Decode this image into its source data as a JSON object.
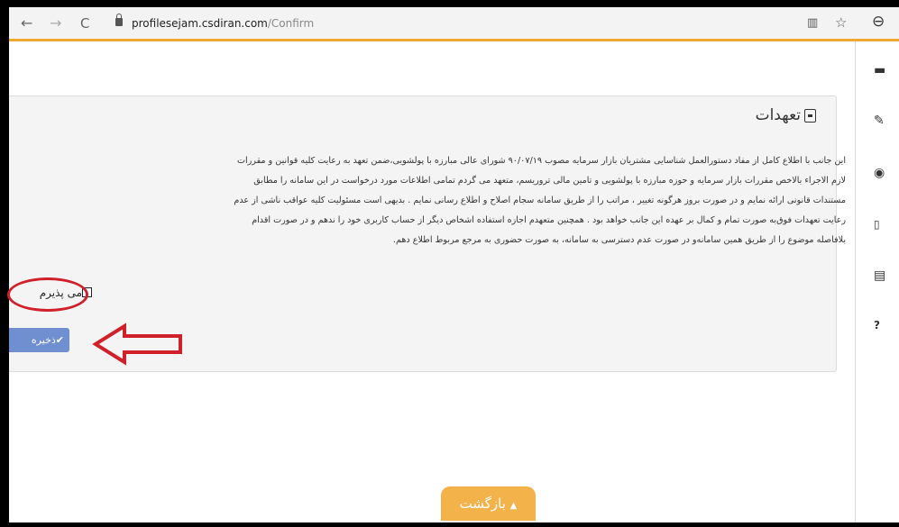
{
  "browser": {
    "url_host": "profilesejam.csdiran.com",
    "url_path": "/Confirm",
    "back_glyph": "←",
    "forward_glyph": "→",
    "reload_glyph": "C",
    "accent_color": "#f0a830"
  },
  "panel": {
    "title": "تعهدات",
    "terms_lines": [
      "این جانب با اطلاع کامل از مفاد دستورالعمل شناسایی مشتریان بازار سرمایه مصوب ۹۰/۰۷/۱۹ شورای عالی مبارزه با پولشویی،ضمن تعهد به رعایت کلیه قوانین و مقررات",
      "لازم الاجراء بالاخص مقررات بازار سرمایه و حوزه مبارزه با پولشویی و تامین مالی تروریسم، متعهد می گردم تمامی اطلاعات مورد درخواست در این سامانه را مطابق",
      "مستندات قانونی ارائه نمایم و در صورت بروز هرگونه تغییر ، مراتب را از طریق سامانه سجام اصلاح و اطلاع رسانی نمایم . بدیهی است مسئولیت کلیه عواقب ناشی از عدم",
      "رعایت تعهدات فوق‌به صورت تمام و کمال بر عهده این جانب خواهد بود . همچنین متعهدم اجازه استفاده اشخاص دیگر از حساب کاربری خود را ندهم و در صورت اقدام",
      "بلافاصله موضوع را از طریق همین سامانه‌و در صورت عدم دسترسی به سامانه، به صورت حضوری به مرجع مربوط اطلاع دهم."
    ],
    "accept_label": "می پذیرم",
    "save_label": "ذخیره",
    "save_color": "#6f8fd0"
  },
  "annotation": {
    "ellipse_color": "#d0202a",
    "arrow_color": "#d0202a"
  },
  "footer": {
    "back_label": "بازگشت",
    "back_color": "#f3b24a"
  },
  "sidebar_icons": [
    "card-icon",
    "edit-icon",
    "eye-icon",
    "mobile-icon",
    "document-icon",
    "help-icon"
  ]
}
